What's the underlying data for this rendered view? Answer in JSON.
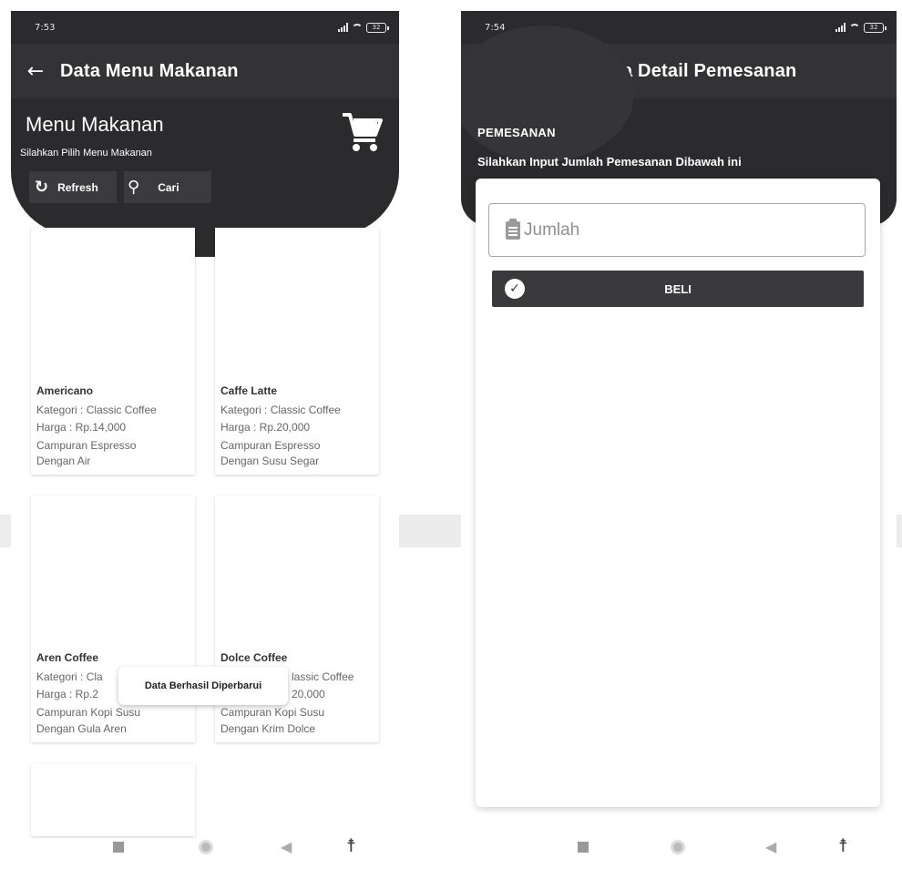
{
  "left_screen": {
    "status_bar": {
      "time": "7:53",
      "battery": "32"
    },
    "app_bar": {
      "title": "Data Menu Makanan",
      "back_icon": "arrow-left-icon"
    },
    "header": {
      "title": "Menu Makanan",
      "subtitle": "Silahkan Pilih Menu Makanan",
      "cart_icon": "shopping-cart-icon",
      "refresh_label": "Refresh",
      "search_label": "Cari"
    },
    "menu_items": [
      {
        "name": "Americano",
        "category": "Kategori : Classic Coffee",
        "price": "Harga : Rp.14,000",
        "desc1": "Campuran Espresso",
        "desc2": "Dengan Air"
      },
      {
        "name": "Caffe Latte",
        "category": "Kategori : Classic Coffee",
        "price": "Harga : Rp.20,000",
        "desc1": "Campuran Espresso",
        "desc2": "Dengan Susu Segar"
      },
      {
        "name": "Aren Coffee",
        "category": "Kategori : Cla",
        "price": "Harga : Rp.2",
        "desc1": "Campuran Kopi Susu",
        "desc2": "Dengan Gula Aren"
      },
      {
        "name": "Dolce Coffee",
        "category": "lassic Coffee",
        "price": "20,000",
        "desc1": "Campuran Kopi Susu",
        "desc2": "Dengan Krim Dolce"
      }
    ],
    "toast": "Data Berhasil Diperbarui"
  },
  "right_screen": {
    "status_bar": {
      "time": "7:54",
      "battery": "32"
    },
    "app_bar": {
      "title": "Tambah Data Detail Pemesanan",
      "back_icon": "arrow-left-icon"
    },
    "header": {
      "title": "PEMESANAN",
      "subtitle": "Silahkan Input Jumlah Pemesanan Dibawah ini"
    },
    "form": {
      "jumlah_placeholder": "Jumlah",
      "jumlah_value": "",
      "buy_label": "BELI"
    }
  },
  "colors": {
    "dark": "#2b2b2d",
    "appbar": "#333335",
    "button": "#3a3a3c"
  }
}
